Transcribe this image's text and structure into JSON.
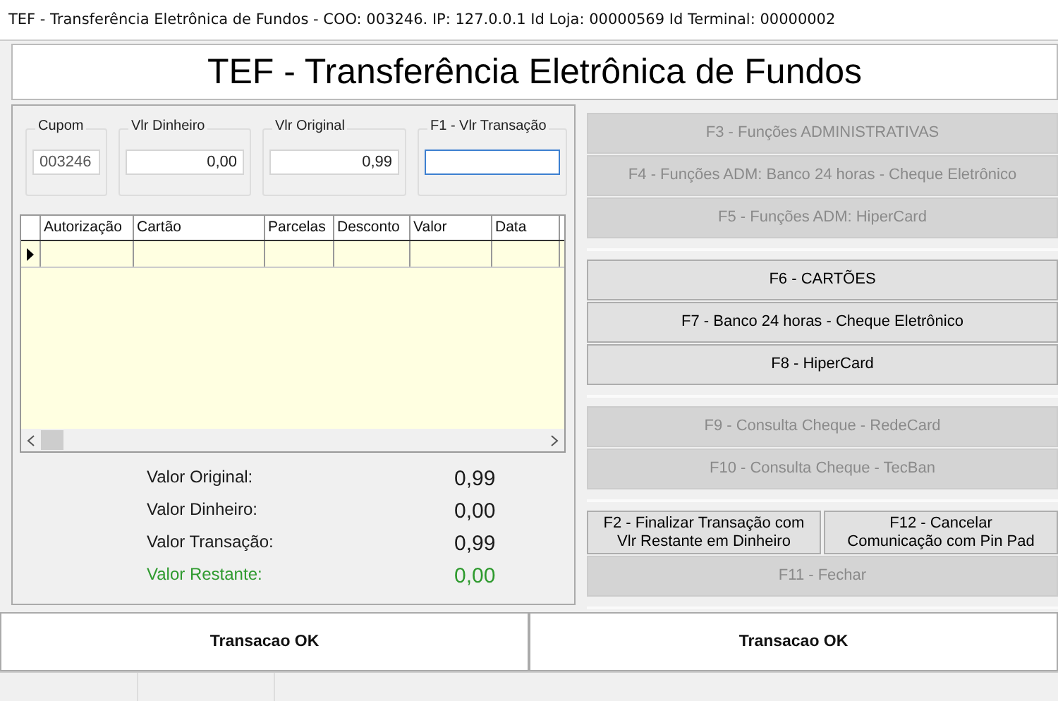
{
  "window": {
    "title": "TEF - Transferência Eletrônica de Fundos - COO: 003246. IP: 127.0.0.1 Id Loja: 00000569 Id Terminal: 00000002"
  },
  "header": {
    "title": "TEF - Transferência Eletrônica de Fundos"
  },
  "fields": [
    {
      "label": "Cupom",
      "value": "003246",
      "disabled": true,
      "focused": false
    },
    {
      "label": "Vlr Dinheiro",
      "value": "0,00",
      "disabled": false,
      "focused": false
    },
    {
      "label": "Vlr Original",
      "value": "0,99",
      "disabled": false,
      "focused": false
    },
    {
      "label": "F1 - Vlr Transação",
      "disabled": false,
      "focused": true
    }
  ],
  "table": {
    "columns": [
      "Autorização",
      "Cartão",
      "Parcelas",
      "Desconto",
      "Valor",
      "Data"
    ],
    "rows": [
      {
        "current": true
      }
    ]
  },
  "summary": [
    {
      "label": "Valor Original:",
      "value": "0,99",
      "color": "#1a1a1a"
    },
    {
      "label": "Valor Dinheiro:",
      "value": "0,00",
      "color": "#1a1a1a"
    },
    {
      "label": "Valor Transação:",
      "value": "0,99",
      "color": "#1a1a1a"
    },
    {
      "label": "Valor Restante:",
      "value": "0,00",
      "color": "#2e9a2e"
    }
  ],
  "button_groups": [
    [
      {
        "label": "F3 - Funções ADMINISTRATIVAS",
        "disabled": true
      },
      {
        "label": "F4 - Funções ADM: Banco 24 horas - Cheque Eletrônico",
        "disabled": true
      },
      {
        "label": "F5 - Funções ADM: HiperCard",
        "disabled": true
      }
    ],
    [
      {
        "label": "F6 - CARTÕES",
        "disabled": false
      },
      {
        "label": "F7 - Banco 24 horas - Cheque Eletrônico",
        "disabled": false
      },
      {
        "label": "F8 - HiperCard",
        "disabled": false
      }
    ],
    [
      {
        "label": "F9 - Consulta Cheque - RedeCard",
        "disabled": true
      },
      {
        "label": "F10 - Consulta Cheque - TecBan",
        "disabled": true
      }
    ]
  ],
  "action_buttons": [
    {
      "label": "F2 - Finalizar Transação com\nVlr Restante em Dinheiro",
      "disabled": false
    },
    {
      "label": "F12 - Cancelar\nComunicação com Pin Pad",
      "disabled": false
    }
  ],
  "close_button": {
    "label": "F11 - Fechar",
    "disabled": true
  },
  "messages": [
    "Transacao OK",
    "Transacao OK"
  ]
}
